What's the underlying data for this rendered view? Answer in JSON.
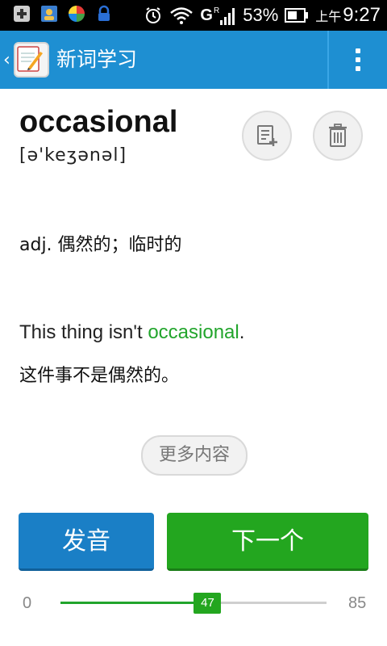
{
  "status_bar": {
    "battery_percent": "53%",
    "network": "G",
    "roaming": "R",
    "time_prefix": "上午",
    "time": "9:27"
  },
  "app_bar": {
    "title": "新词学习"
  },
  "word": {
    "text": "occasional",
    "phonetic": "[ə'keʒənəl]",
    "definition": "adj. 偶然的；临时的"
  },
  "example": {
    "en_before": "This thing isn't ",
    "en_highlight": "occasional",
    "en_after": ".",
    "zh": "这件事不是偶然的。"
  },
  "buttons": {
    "more": "更多内容",
    "pronounce": "发音",
    "next": "下一个"
  },
  "progress": {
    "min": "0",
    "max": "85",
    "current": "47",
    "fraction": 0.553
  },
  "colors": {
    "primary_blue": "#1e8fd2",
    "accent_green": "#23a61f"
  }
}
